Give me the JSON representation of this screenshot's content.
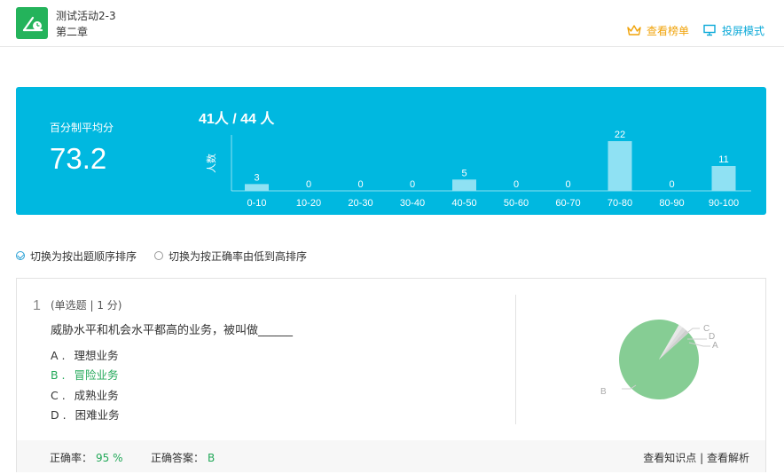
{
  "header": {
    "title": "测试活动2-3",
    "subtitle": "第二章",
    "rank_label": "查看榜单",
    "projection_label": "投屏模式"
  },
  "stats": {
    "avg_label": "百分制平均分",
    "avg_value": "73.2",
    "participants": "41人 / 44 人",
    "ylabel": "人数"
  },
  "chart_data": [
    {
      "type": "bar",
      "title": "",
      "xlabel": "",
      "ylabel": "人数",
      "categories": [
        "0-10",
        "10-20",
        "20-30",
        "30-40",
        "40-50",
        "50-60",
        "60-70",
        "70-80",
        "80-90",
        "90-100"
      ],
      "values": [
        3,
        0,
        0,
        0,
        5,
        0,
        0,
        22,
        0,
        11
      ],
      "ylim": [
        0,
        22
      ],
      "grid": false
    },
    {
      "type": "pie",
      "labels": [
        "B",
        "C",
        "D",
        "A"
      ],
      "values": [
        95,
        1.7,
        1.7,
        1.6
      ],
      "colors": [
        "#86cd94",
        "#e8e8e8",
        "#dcdcdc",
        "#cfcfcf"
      ]
    }
  ],
  "sort": {
    "option1": "切换为按出题顺序排序",
    "option2": "切换为按正确率由低到高排序"
  },
  "question": {
    "number": "1",
    "meta": "(单选题 | 1 分)",
    "text": "威胁水平和机会水平都高的业务，被叫做______",
    "options": [
      {
        "letter": "A .",
        "text": "理想业务",
        "correct": false
      },
      {
        "letter": "B .",
        "text": "冒险业务",
        "correct": true
      },
      {
        "letter": "C .",
        "text": "成熟业务",
        "correct": false
      },
      {
        "letter": "D .",
        "text": "困难业务",
        "correct": false
      }
    ],
    "accuracy_label": "正确率：",
    "accuracy_value": "95 %",
    "answer_label": "正确答案：",
    "answer_value": "B",
    "knowledge_link": "查看知识点",
    "separator": "|",
    "analysis_link": "查看解析"
  }
}
